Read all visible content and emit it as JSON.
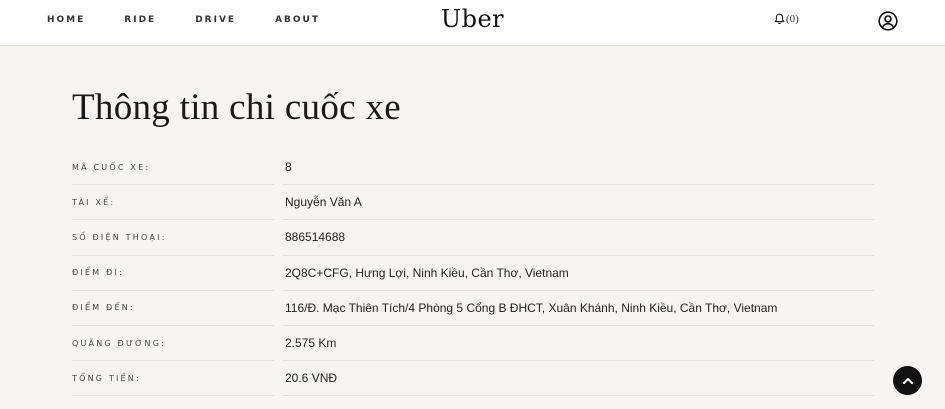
{
  "nav": {
    "items": [
      "HOME",
      "RIDE",
      "DRIVE",
      "ABOUT"
    ]
  },
  "brand": {
    "logo_text": "Uber"
  },
  "notifications": {
    "icon": "bell-icon",
    "count_text": "(0)"
  },
  "account": {
    "icon": "user-circle-icon"
  },
  "page": {
    "title": "Thông tin chi cuốc xe"
  },
  "details": [
    {
      "label": "Mã cuốc xe:",
      "value": "8"
    },
    {
      "label": "Tài xế:",
      "value": "Nguyễn Văn A"
    },
    {
      "label": "Số điện thoại:",
      "value": "886514688"
    },
    {
      "label": "Điểm đi:",
      "value": "2Q8C+CFG, Hưng Lợi, Ninh Kiều, Cần Thơ, Vietnam"
    },
    {
      "label": "Điểm đến:",
      "value": "116/Đ. Mạc Thiên Tích/4 Phòng 5 Cổng B ĐHCT, Xuân Khánh, Ninh Kiều, Cần Thơ, Vietnam"
    },
    {
      "label": "Quãng đường:",
      "value": "2.575 Km"
    },
    {
      "label": "Tổng tiền:",
      "value": "20.6 VNĐ"
    }
  ],
  "scroll_top": {
    "icon": "chevron-up-icon"
  },
  "colors": {
    "background": "#f6f5f2",
    "header": "#ffffff",
    "text": "#222222",
    "button": "#111111"
  }
}
